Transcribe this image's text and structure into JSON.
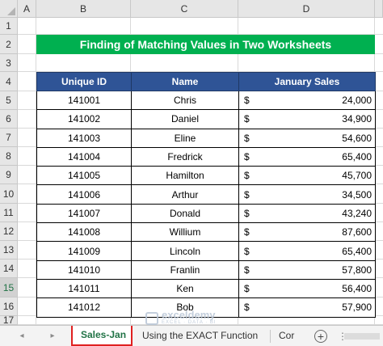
{
  "columns": [
    "A",
    "B",
    "C",
    "D"
  ],
  "rows": [
    "1",
    "2",
    "3",
    "4",
    "5",
    "6",
    "7",
    "8",
    "9",
    "10",
    "11",
    "12",
    "13",
    "14",
    "15",
    "16",
    "17"
  ],
  "active_row": "15",
  "title": "Finding of Matching Values in Two Worksheets",
  "table": {
    "headers": [
      "Unique ID",
      "Name",
      "January Sales"
    ],
    "currency_symbol": "$",
    "rows": [
      {
        "id": "141001",
        "name": "Chris",
        "sales": "24,000"
      },
      {
        "id": "141002",
        "name": "Daniel",
        "sales": "34,900"
      },
      {
        "id": "141003",
        "name": "Eline",
        "sales": "54,600"
      },
      {
        "id": "141004",
        "name": "Fredrick",
        "sales": "65,400"
      },
      {
        "id": "141005",
        "name": "Hamilton",
        "sales": "45,700"
      },
      {
        "id": "141006",
        "name": "Arthur",
        "sales": "34,500"
      },
      {
        "id": "141007",
        "name": "Donald",
        "sales": "43,240"
      },
      {
        "id": "141008",
        "name": "Willium",
        "sales": "87,600"
      },
      {
        "id": "141009",
        "name": "Lincoln",
        "sales": "65,400"
      },
      {
        "id": "141010",
        "name": "Franlin",
        "sales": "57,800"
      },
      {
        "id": "141011",
        "name": "Ken",
        "sales": "56,400"
      },
      {
        "id": "141012",
        "name": "Bob",
        "sales": "57,900"
      }
    ]
  },
  "watermark": {
    "name": "exceldemy",
    "sub": "EXCEL · DATA · BI"
  },
  "tabs": {
    "active": "Sales-Jan",
    "second": "Using the EXACT Function",
    "third": "Cor",
    "add_symbol": "+",
    "prev_symbol": "◂",
    "next_symbol": "▸",
    "more_symbol": "⋮"
  },
  "colors": {
    "title_bg": "#00b050",
    "header_bg": "#2f5496",
    "active_tab_border": "#e02020",
    "active_tab_text": "#217346"
  }
}
